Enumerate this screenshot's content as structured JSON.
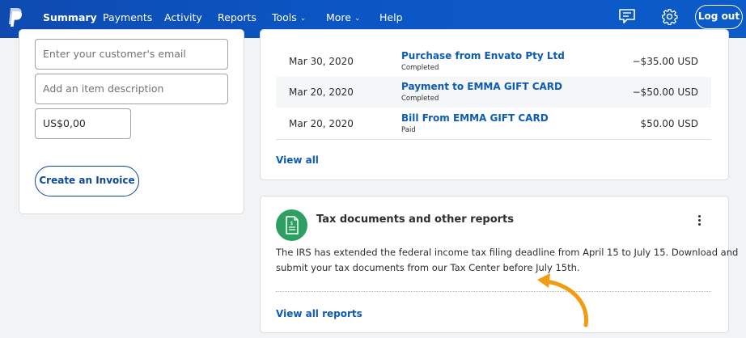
{
  "nav": {
    "items": [
      {
        "label": "Summary"
      },
      {
        "label": "Payments"
      },
      {
        "label": "Activity"
      },
      {
        "label": "Reports"
      },
      {
        "label": "Tools"
      },
      {
        "label": "More"
      },
      {
        "label": "Help"
      }
    ],
    "active": "Summary",
    "logout_label": "Log out"
  },
  "invoice_form": {
    "email_placeholder": "Enter your customer's email",
    "description_placeholder": "Add an item description",
    "amount_value": "US$0,00",
    "create_button": "Create an Invoice"
  },
  "transactions": {
    "rows": [
      {
        "date": "Mar 30, 2020",
        "title": "Purchase from Envato Pty Ltd",
        "status": "Completed",
        "amount": "−$35.00 USD"
      },
      {
        "date": "Mar 20, 2020",
        "title": "Payment to EMMA GIFT CARD",
        "status": "Completed",
        "amount": "−$50.00 USD"
      },
      {
        "date": "Mar 20, 2020",
        "title": "Bill From EMMA GIFT CARD",
        "status": "Paid",
        "amount": "$50.00 USD"
      }
    ],
    "view_all": "View all"
  },
  "tax": {
    "title": "Tax documents and other reports",
    "line1": "The IRS has extended the federal income tax filing deadline from April 15 to July 15. Download and",
    "line2": "submit your tax documents from our Tax Center before July 15th.",
    "view_all_reports": "View all reports"
  },
  "colors": {
    "header_blue": "#0b56c4",
    "link_blue": "#0c5bb5",
    "icon_green": "#2e9f63",
    "arrow_orange": "#f39c12"
  },
  "icons": [
    "paypal-logo",
    "message-icon",
    "gear-icon",
    "tax-document-icon",
    "more-vertical-icon",
    "curved-arrow-icon"
  ]
}
